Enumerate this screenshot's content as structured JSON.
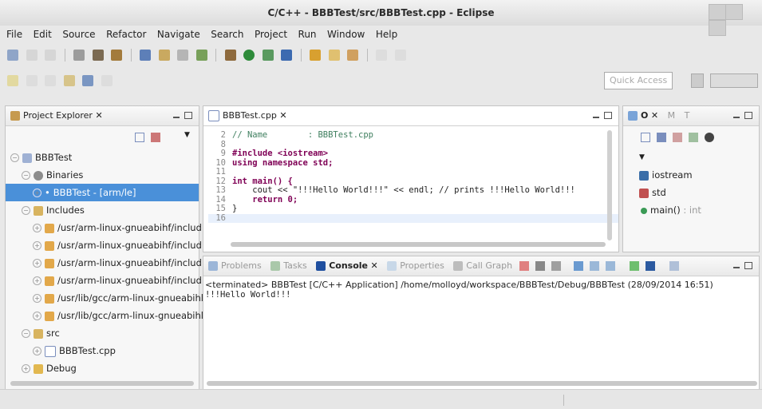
{
  "window": {
    "title": "C/C++ - BBBTest/src/BBBTest.cpp - Eclipse"
  },
  "menu": [
    "File",
    "Edit",
    "Source",
    "Refactor",
    "Navigate",
    "Search",
    "Project",
    "Run",
    "Window",
    "Help"
  ],
  "quick_access": {
    "placeholder": "Quick Access"
  },
  "project_explorer": {
    "title": "Project Explorer",
    "items": [
      {
        "label": "BBBTest"
      },
      {
        "label": "Binaries"
      },
      {
        "label": "BBBTest - [arm/le]"
      },
      {
        "label": "Includes"
      },
      {
        "label": "/usr/arm-linux-gnueabihf/includ"
      },
      {
        "label": "/usr/arm-linux-gnueabihf/includ"
      },
      {
        "label": "/usr/arm-linux-gnueabihf/includ"
      },
      {
        "label": "/usr/arm-linux-gnueabihf/includ"
      },
      {
        "label": "/usr/lib/gcc/arm-linux-gnueabihl"
      },
      {
        "label": "/usr/lib/gcc/arm-linux-gnueabihl"
      },
      {
        "label": "src"
      },
      {
        "label": "BBBTest.cpp"
      },
      {
        "label": "Debug"
      }
    ]
  },
  "editor": {
    "tab": "BBBTest.cpp",
    "lines": [
      {
        "num": "2",
        "text": "// Name        : BBBTest.cpp"
      },
      {
        "num": "8",
        "text": ""
      },
      {
        "num": "9",
        "text": "#include <iostream>"
      },
      {
        "num": "10",
        "text": "using namespace std;"
      },
      {
        "num": "11",
        "text": ""
      },
      {
        "num": "12",
        "text": "int main() {"
      },
      {
        "num": "13",
        "text": "    cout << \"!!!Hello World!!!\" << endl; // prints !!!Hello World!!!"
      },
      {
        "num": "14",
        "text": "    return 0;"
      },
      {
        "num": "15",
        "text": "}"
      },
      {
        "num": "16",
        "text": ""
      }
    ]
  },
  "outline": {
    "tabs": [
      "O",
      "M",
      "T"
    ],
    "items": [
      {
        "label": "iostream",
        "type": ""
      },
      {
        "label": "std",
        "type": ""
      },
      {
        "label": "main()",
        "type": ": int"
      }
    ]
  },
  "bottom_tabs": [
    "Problems",
    "Tasks",
    "Console",
    "Properties",
    "Call Graph"
  ],
  "console": {
    "header": "<terminated> BBBTest [C/C++ Application] /home/molloyd/workspace/BBBTest/Debug/BBBTest (28/09/2014 16:51)",
    "output": "!!!Hello World!!!"
  }
}
